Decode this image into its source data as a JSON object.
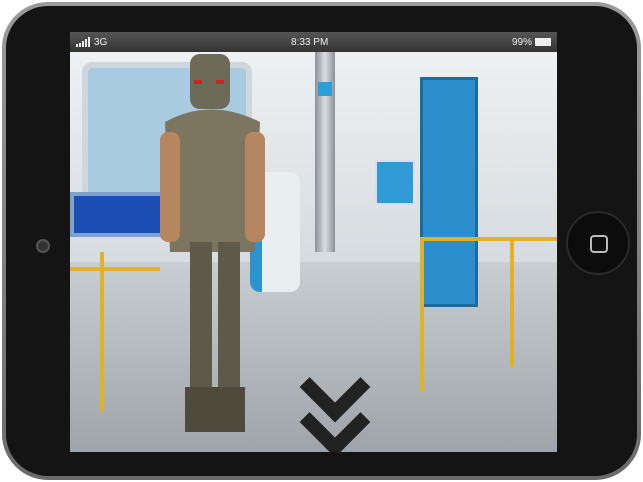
{
  "status_bar": {
    "carrier": "3G",
    "time": "8:33 PM",
    "battery": "99%",
    "signal_bars": 5
  },
  "device": {
    "home_button": "home-button"
  }
}
